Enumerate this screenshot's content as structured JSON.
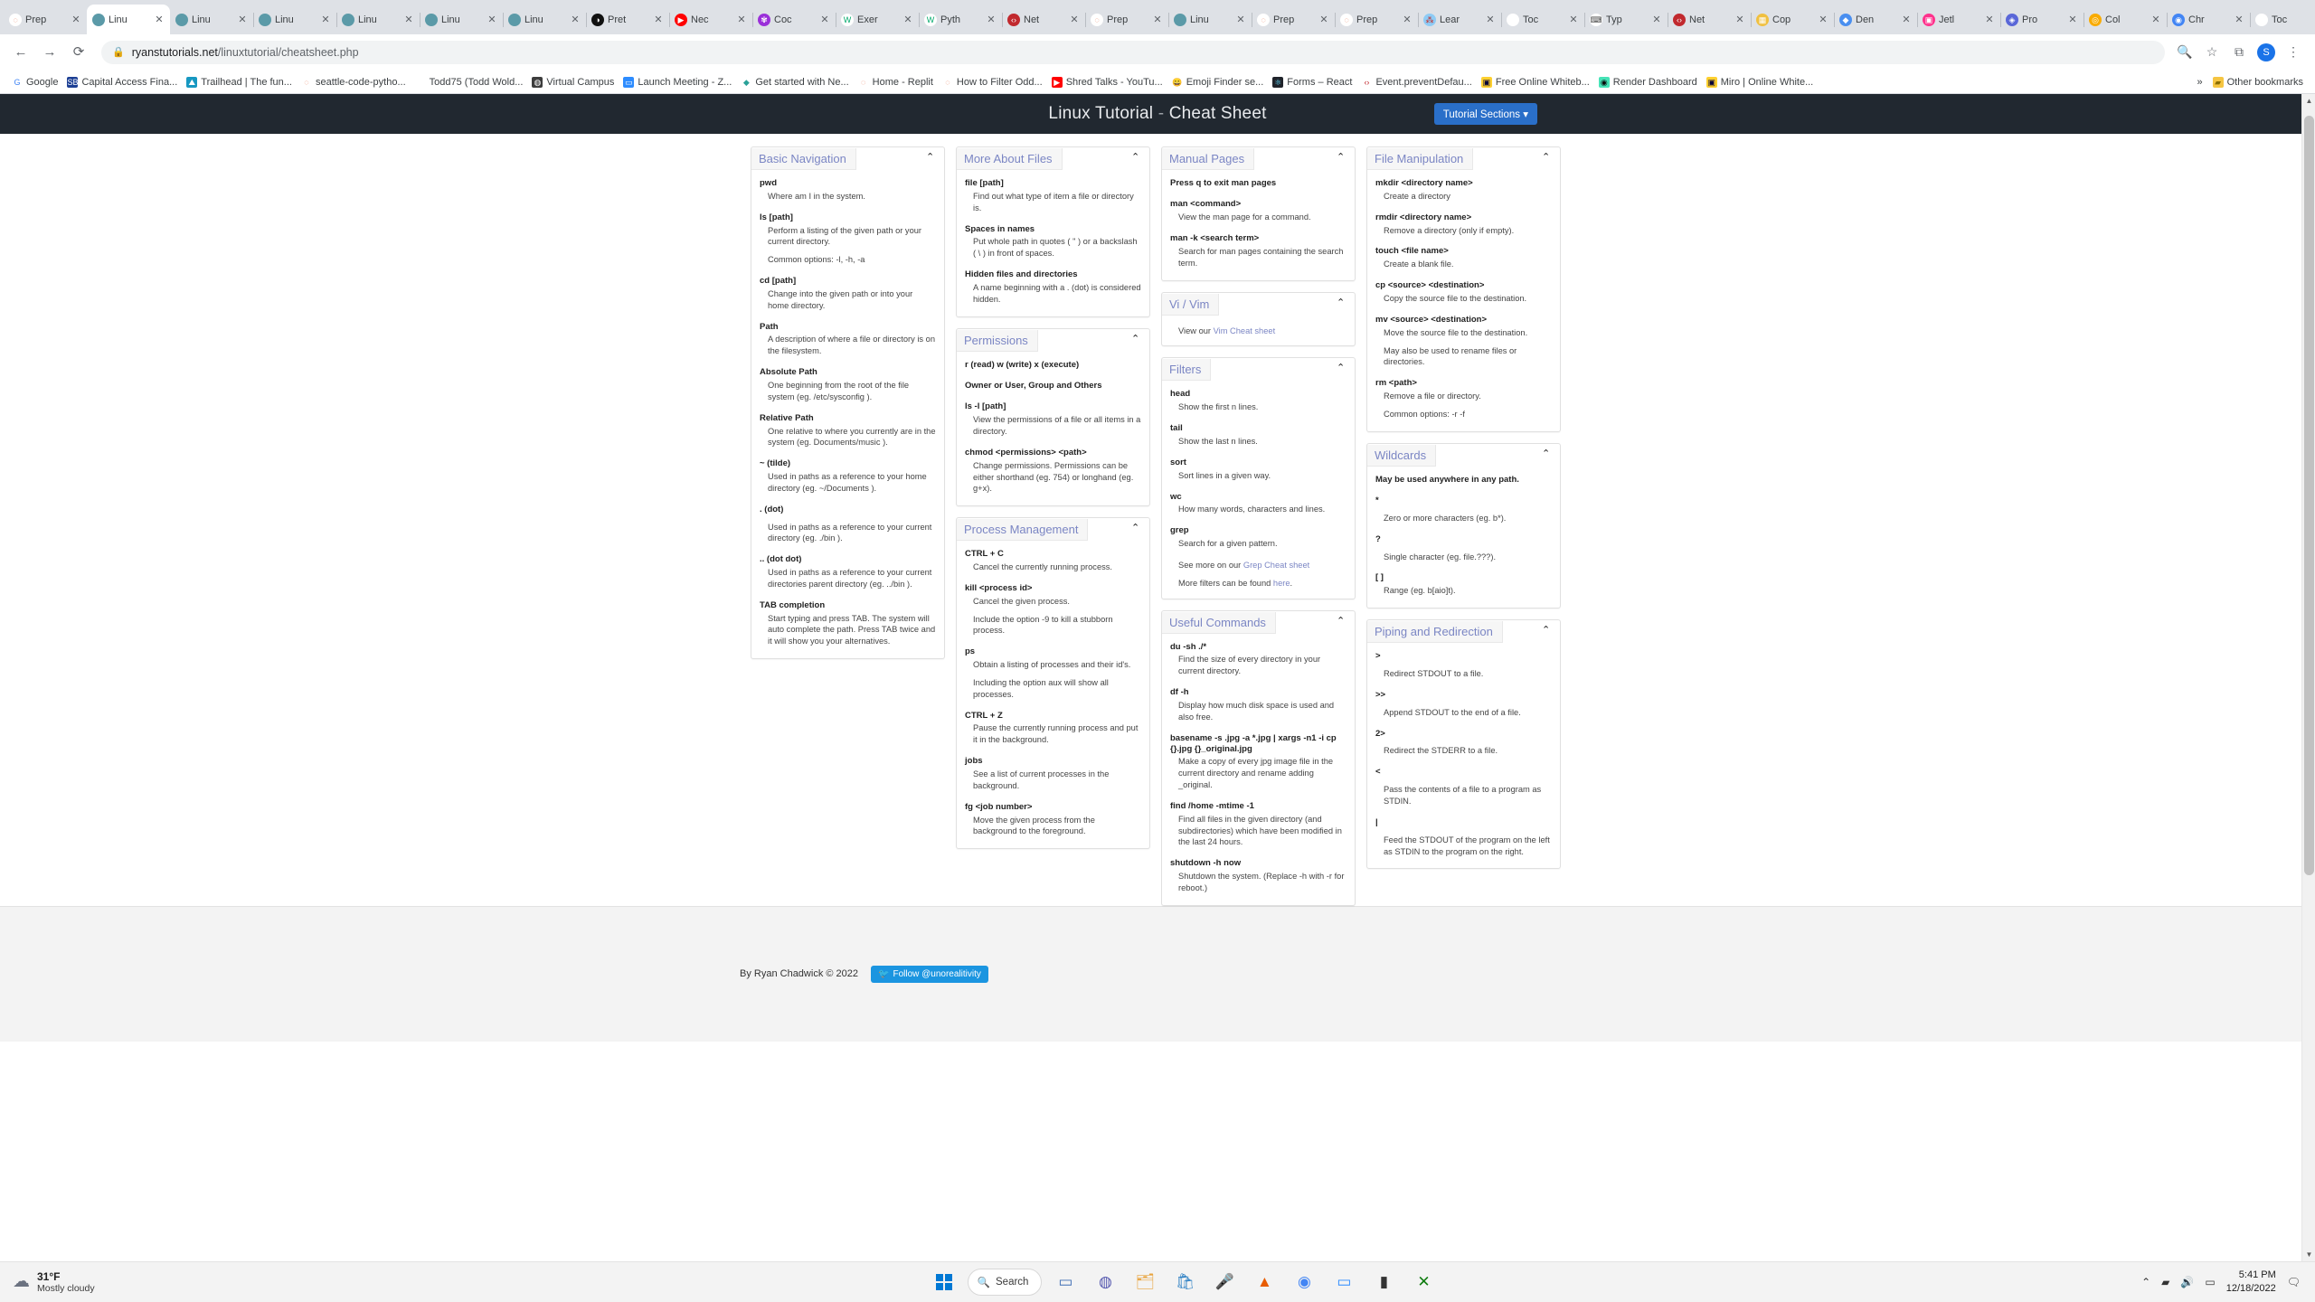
{
  "browser": {
    "tabs": [
      {
        "label": "Prep",
        "icon": "replit-icon",
        "color": "#ffffff",
        "glyph": "◌",
        "fg": "#e8744f",
        "active": false
      },
      {
        "label": "Linu",
        "icon": "linux-tutorial-icon",
        "color": "#5b9aa8",
        "glyph": "",
        "fg": "#ffffff",
        "active": true
      },
      {
        "label": "Linu",
        "icon": "linux-tutorial-icon",
        "color": "#5b9aa8",
        "glyph": "",
        "fg": "#ffffff",
        "active": false
      },
      {
        "label": "Linu",
        "icon": "linux-tutorial-icon",
        "color": "#5b9aa8",
        "glyph": "",
        "fg": "#ffffff",
        "active": false
      },
      {
        "label": "Linu",
        "icon": "linux-tutorial-icon",
        "color": "#5b9aa8",
        "glyph": "",
        "fg": "#ffffff",
        "active": false
      },
      {
        "label": "Linu",
        "icon": "linux-tutorial-icon",
        "color": "#5b9aa8",
        "glyph": "",
        "fg": "#ffffff",
        "active": false
      },
      {
        "label": "Linu",
        "icon": "linux-tutorial-icon",
        "color": "#5b9aa8",
        "glyph": "",
        "fg": "#ffffff",
        "active": false
      },
      {
        "label": "Pret",
        "icon": "prettier-icon",
        "color": "#111111",
        "glyph": "◑",
        "fg": "#ffffff",
        "active": false
      },
      {
        "label": "Nec",
        "icon": "youtube-icon",
        "color": "#ff0000",
        "glyph": "▶",
        "fg": "#ffffff",
        "active": false
      },
      {
        "label": "Coc",
        "icon": "codecademy-icon",
        "color": "#9b30d9",
        "glyph": "✾",
        "fg": "#ffffff",
        "active": false
      },
      {
        "label": "Exer",
        "icon": "w3schools-icon",
        "color": "#ffffff",
        "glyph": "W",
        "fg": "#04aa6d",
        "active": false
      },
      {
        "label": "Pyth",
        "icon": "w3schools-icon",
        "color": "#ffffff",
        "glyph": "W",
        "fg": "#04aa6d",
        "active": false
      },
      {
        "label": "Net",
        "icon": "mdn-icon",
        "color": "#c1292e",
        "glyph": "‹›",
        "fg": "#ffffff",
        "active": false
      },
      {
        "label": "Prep",
        "icon": "replit-icon",
        "color": "#ffffff",
        "glyph": "◌",
        "fg": "#e8744f",
        "active": false
      },
      {
        "label": "Linu",
        "icon": "linux-tutorial-icon",
        "color": "#5b9aa8",
        "glyph": "",
        "fg": "#ffffff",
        "active": false
      },
      {
        "label": "Prep",
        "icon": "replit-icon",
        "color": "#ffffff",
        "glyph": "◌",
        "fg": "#e8744f",
        "active": false
      },
      {
        "label": "Prep",
        "icon": "replit-icon",
        "color": "#ffffff",
        "glyph": "◌",
        "fg": "#e8744f",
        "active": false
      },
      {
        "label": "Lear",
        "icon": "learn-icon",
        "color": "#8ecbf5",
        "glyph": "⁂",
        "fg": "#c4302b",
        "active": false
      },
      {
        "label": "Toc",
        "icon": "github-icon",
        "color": "#ffffff",
        "glyph": "",
        "fg": "#24292e",
        "active": false
      },
      {
        "label": "Typ",
        "icon": "typing-icon",
        "color": "#ffffff",
        "glyph": "⌨",
        "fg": "#444444",
        "active": false
      },
      {
        "label": "Net",
        "icon": "mdn-icon",
        "color": "#c1292e",
        "glyph": "‹›",
        "fg": "#ffffff",
        "active": false
      },
      {
        "label": "Cop",
        "icon": "copy-icon",
        "color": "#f0c040",
        "glyph": "▦",
        "fg": "#ffffff",
        "active": false
      },
      {
        "label": "Den",
        "icon": "demo-icon",
        "color": "#4a8ff0",
        "glyph": "◆",
        "fg": "#ffffff",
        "active": false
      },
      {
        "label": "Jetl",
        "icon": "jetbrains-icon",
        "color": "#ff318c",
        "glyph": "▣",
        "fg": "#ffffff",
        "active": false
      },
      {
        "label": "Pro",
        "icon": "project-icon",
        "color": "#5a67d8",
        "glyph": "◈",
        "fg": "#ffffff",
        "active": false
      },
      {
        "label": "Col",
        "icon": "colab-icon",
        "color": "#f9ab00",
        "glyph": "◎",
        "fg": "#ffffff",
        "active": false
      },
      {
        "label": "Chr",
        "icon": "chrome-icon",
        "color": "#4285f4",
        "glyph": "◉",
        "fg": "#ffffff",
        "active": false
      },
      {
        "label": "Toc",
        "icon": "github-icon",
        "color": "#ffffff",
        "glyph": "",
        "fg": "#24292e",
        "active": false
      }
    ],
    "close_glyph": "✕",
    "new_tab_glyph": "+",
    "window_controls": {
      "minimize": "—",
      "maximize": "□",
      "close": "✕"
    },
    "nav": {
      "back": "←",
      "forward": "→",
      "reload": "⟳",
      "lock": "🔒"
    },
    "url": {
      "host": "ryanstutorials.net",
      "path": "/linuxtutorial/cheatsheet.php"
    },
    "toolbar_right": {
      "star": "☆",
      "extensions": "⚙",
      "split": "⧉",
      "profile": "S",
      "menu": "⋮"
    },
    "bookmarks": [
      {
        "label": "Google",
        "glyph": "G",
        "bg": "#ffffff",
        "fg": "#4285f4"
      },
      {
        "label": "Capital Access Fina...",
        "glyph": "SBA",
        "bg": "#1c3f94",
        "fg": "#ffffff"
      },
      {
        "label": "Trailhead | The fun...",
        "glyph": "⛰",
        "bg": "#1798c1",
        "fg": "#ffffff"
      },
      {
        "label": "seattle-code-pytho...",
        "glyph": "◌",
        "bg": "#ffffff",
        "fg": "#e8744f"
      },
      {
        "label": "Todd75 (Todd Wold...",
        "glyph": "",
        "bg": "#ffffff",
        "fg": "#24292e"
      },
      {
        "label": "Virtual Campus",
        "glyph": "◍",
        "bg": "#3d3d3d",
        "fg": "#ffffff"
      },
      {
        "label": "Launch Meeting - Z...",
        "glyph": "▭",
        "bg": "#2d8cff",
        "fg": "#ffffff"
      },
      {
        "label": "Get started with Ne...",
        "glyph": "◆",
        "bg": "#ffffff",
        "fg": "#2aa198"
      },
      {
        "label": "Home - Replit",
        "glyph": "◌",
        "bg": "#ffffff",
        "fg": "#e8744f"
      },
      {
        "label": "How to Filter Odd...",
        "glyph": "◌",
        "bg": "#ffffff",
        "fg": "#e8744f"
      },
      {
        "label": "Shred Talks - YouTu...",
        "glyph": "▶",
        "bg": "#ff0000",
        "fg": "#ffffff"
      },
      {
        "label": "Emoji Finder se...",
        "glyph": "😀",
        "bg": "#ffffff",
        "fg": "#f5b301"
      },
      {
        "label": "Forms – React",
        "glyph": "⚛",
        "bg": "#20232a",
        "fg": "#61dafb"
      },
      {
        "label": "Event.preventDefau...",
        "glyph": "‹›",
        "bg": "#ffffff",
        "fg": "#c1292e"
      },
      {
        "label": "Free Online Whiteb...",
        "glyph": "▣",
        "bg": "#ffd02f",
        "fg": "#050038"
      },
      {
        "label": "Render Dashboard",
        "glyph": "◉",
        "bg": "#46e3b7",
        "fg": "#0b0d0e"
      },
      {
        "label": "Miro | Online White...",
        "glyph": "▣",
        "bg": "#ffd02f",
        "fg": "#050038"
      }
    ],
    "other_bookmarks": {
      "label": "Other bookmarks",
      "glyph": "▸",
      "folder": "🗀"
    },
    "bookmarks_overflow": "»"
  },
  "page": {
    "title_main": "Linux Tutorial",
    "title_dash": " - ",
    "title_sub": "Cheat Sheet",
    "tutorial_button": "Tutorial Sections ▾",
    "footer_text": "By Ryan Chadwick © 2022",
    "twitter_button": "Follow @unorealitivity",
    "twitter_glyph": "🐦",
    "collapse_glyph": "⌃"
  },
  "sections": {
    "basic_navigation": {
      "title": "Basic Navigation",
      "entries": [
        {
          "term": "pwd",
          "desc": "Where am I in the system."
        },
        {
          "term": "ls [path]",
          "desc": "Perform a listing of the given path or your current directory.",
          "note": "Common options: -l, -h, -a"
        },
        {
          "term": "cd [path]",
          "desc": "Change into the given path or into your home directory."
        },
        {
          "term": "Path",
          "desc": "A description of where a file or directory is on the filesystem."
        },
        {
          "term": "Absolute Path",
          "desc": "One beginning from the root of the file system (eg. /etc/sysconfig )."
        },
        {
          "term": "Relative Path",
          "desc": "One relative to where you currently are in the system (eg. Documents/music )."
        },
        {
          "term": "~ (tilde)",
          "desc": "Used in paths as a reference to your home directory (eg. ~/Documents )."
        },
        {
          "term": ". (dot)",
          "desc": "",
          "note": "Used in paths as a reference to your current directory (eg. ./bin )."
        },
        {
          "term": ".. (dot dot)",
          "desc": "Used in paths as a reference to your current directories parent directory (eg. ../bin )."
        },
        {
          "term": "TAB completion",
          "desc": "Start typing and press TAB. The system will auto complete the path. Press TAB twice and it will show you your alternatives."
        }
      ]
    },
    "more_about_files": {
      "title": "More About Files",
      "entries": [
        {
          "term": "file [path]",
          "desc": "Find out what type of item a file or directory is."
        },
        {
          "term": "Spaces in names",
          "desc": "Put whole path in quotes ( \" ) or a backslash ( \\ ) in front of spaces."
        },
        {
          "term": "Hidden files and directories",
          "desc": "A name beginning with a . (dot) is considered hidden."
        }
      ]
    },
    "permissions": {
      "title": "Permissions",
      "plain": [
        "r (read) w (write) x (execute)",
        "Owner or User, Group and Others"
      ],
      "entries": [
        {
          "term": "ls -l [path]",
          "desc": "View the permissions of a file or all items in a directory."
        },
        {
          "term": "chmod <permissions> <path>",
          "desc": "Change permissions. Permissions can be either shorthand (eg. 754) or longhand (eg. g+x)."
        }
      ]
    },
    "process_management": {
      "title": "Process Management",
      "entries": [
        {
          "term": "CTRL + C",
          "desc": "Cancel the currently running process."
        },
        {
          "term": "kill <process id>",
          "desc": "Cancel the given process.",
          "note": "Include the option -9 to kill a stubborn process."
        },
        {
          "term": "ps",
          "desc": "Obtain a listing of processes and their id's.",
          "note": "Including the option aux will show all processes."
        },
        {
          "term": "CTRL + Z",
          "desc": "Pause the currently running process and put it in the background."
        },
        {
          "term": "jobs",
          "desc": "See a list of current processes in the background."
        },
        {
          "term": "fg <job number>",
          "desc": "Move the given process from the background to the foreground."
        }
      ]
    },
    "manual_pages": {
      "title": "Manual Pages",
      "entries": [
        {
          "term": "man <command>",
          "desc": "View the man page for a command."
        },
        {
          "term": "man -k <search term>",
          "desc": "Search for man pages containing the search term."
        }
      ],
      "plain": [
        "Press q to exit man pages"
      ]
    },
    "vi_vim": {
      "title": "Vi / Vim",
      "line_prefix": "View our ",
      "line_link": "Vim Cheat sheet"
    },
    "filters": {
      "title": "Filters",
      "entries": [
        {
          "term": "head",
          "desc": "Show the first n lines."
        },
        {
          "term": "tail",
          "desc": "Show the last n lines."
        },
        {
          "term": "sort",
          "desc": "Sort lines in a given way."
        },
        {
          "term": "wc",
          "desc": "How many words, characters and lines."
        },
        {
          "term": "grep",
          "desc": "Search for a given pattern."
        }
      ],
      "link_line_1_prefix": "See more on our ",
      "link_line_1_link": "Grep Cheat sheet",
      "link_line_2_prefix": "More filters can be found ",
      "link_line_2_link": "here",
      "link_line_2_suffix": "."
    },
    "useful_commands": {
      "title": "Useful Commands",
      "entries": [
        {
          "term": "du -sh ./*",
          "desc": "Find the size of every directory in your current directory."
        },
        {
          "term": "df -h",
          "desc": "Display how much disk space is used and also free."
        },
        {
          "term": "basename -s .jpg -a *.jpg | xargs -n1 -i cp {}.jpg {}_original.jpg",
          "desc": "Make a copy of every jpg image file in the current directory and rename adding _original."
        },
        {
          "term": "find /home -mtime -1",
          "desc": "Find all files in the given directory (and subdirectories) which have been modified in the last 24 hours."
        },
        {
          "term": "shutdown -h now",
          "desc": "Shutdown the system. (Replace -h with -r for reboot.)"
        }
      ]
    },
    "file_manipulation": {
      "title": "File Manipulation",
      "entries": [
        {
          "term": "mkdir <directory name>",
          "desc": "Create a directory"
        },
        {
          "term": "rmdir <directory name>",
          "desc": "Remove a directory (only if empty)."
        },
        {
          "term": "touch <file name>",
          "desc": "Create a blank file."
        },
        {
          "term": "cp <source> <destination>",
          "desc": "Copy the source file to the destination."
        },
        {
          "term": "mv <source> <destination>",
          "desc": "Move the source file to the destination.",
          "note": "May also be used to rename files or directories."
        },
        {
          "term": "rm <path>",
          "desc": "Remove a file or directory.",
          "note": "Common options: -r -f"
        }
      ]
    },
    "wildcards": {
      "title": "Wildcards",
      "plain": [
        "May be used anywhere in any path."
      ],
      "entries": [
        {
          "term": "*",
          "desc": "",
          "note": "Zero or more characters (eg. b*)."
        },
        {
          "term": "?",
          "desc": "",
          "note": "Single character (eg. file.???)."
        },
        {
          "term": "[ ]",
          "desc": "Range (eg. b[aio]t)."
        }
      ]
    },
    "piping_redirection": {
      "title": "Piping and Redirection",
      "entries": [
        {
          "term": ">",
          "desc": "",
          "note": "Redirect STDOUT to a file."
        },
        {
          "term": ">>",
          "desc": "",
          "note": "Append STDOUT to the end of a file."
        },
        {
          "term": "2>",
          "desc": "",
          "note": "Redirect the STDERR to a file."
        },
        {
          "term": "<",
          "desc": "",
          "note": "Pass the contents of a file to a program as STDIN."
        },
        {
          "term": "|",
          "desc": "",
          "note": "Feed the STDOUT of the program on the left as STDIN to the program on the right."
        }
      ]
    }
  },
  "taskbar": {
    "weather_temp": "31°F",
    "weather_desc": "Mostly cloudy",
    "weather_icon": "☁",
    "search_label": "Search",
    "search_glyph": "🔍",
    "icons": [
      {
        "name": "task-view-icon",
        "glyph": "▭",
        "color": "#3f6fb5"
      },
      {
        "name": "teams-icon",
        "glyph": "◍",
        "color": "#5558af"
      },
      {
        "name": "file-explorer-icon",
        "glyph": "🗂",
        "color": "#e8a33d"
      },
      {
        "name": "store-icon",
        "glyph": "🛍",
        "color": "#2b7fc4"
      },
      {
        "name": "mic-icon",
        "glyph": "🎤",
        "color": "#3c3c3c"
      },
      {
        "name": "vlc-icon",
        "glyph": "▲",
        "color": "#e85d04"
      },
      {
        "name": "chrome-icon",
        "glyph": "◉",
        "color": "#4285f4"
      },
      {
        "name": "zoom-icon",
        "glyph": "▭",
        "color": "#2d8cff"
      },
      {
        "name": "terminal-icon",
        "glyph": "▮",
        "color": "#333333"
      },
      {
        "name": "xbox-icon",
        "glyph": "✕",
        "color": "#107c10"
      }
    ],
    "tray": {
      "chevron": "⌃",
      "network": "▰",
      "volume": "🔊",
      "battery": "▭"
    },
    "time": "5:41 PM",
    "date": "12/18/2022",
    "notification_glyph": "🗨"
  }
}
